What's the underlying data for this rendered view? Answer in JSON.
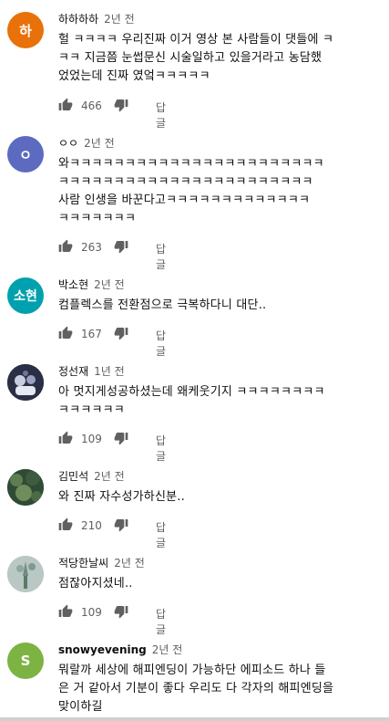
{
  "reply_label": "답글",
  "comments": [
    {
      "author": "하하하하",
      "time": "2년 전",
      "avatar_letter": "하",
      "avatar_color": "#e8710a",
      "lines": [
        "헐 ㅋㅋㅋㅋ 우리진짜 이거 영상 본 사람들이 댓들에 ㅋ",
        "ㅋㅋ 지금쯤 눈썹문신 시술일하고 있을거라고 농담했",
        "었었는데 진짜 였엌ㅋㅋㅋㅋㅋ"
      ],
      "likes": "466"
    },
    {
      "author": "ㅇㅇ",
      "time": "2년 전",
      "avatar_letter": "ㅇ",
      "avatar_color": "#5c6bc0",
      "lines": [
        "와ㅋㅋㅋㅋㅋㅋㅋㅋㅋㅋㅋㅋㅋㅋㅋㅋㅋㅋㅋㅋㅋㅋㅋ",
        "ㅋㅋㅋㅋㅋㅋㅋㅋㅋㅋㅋㅋㅋㅋㅋㅋㅋㅋㅋㅋㅋㅋㅋ",
        "사람 인생을 바꾼다고ㅋㅋㅋㅋㅋㅋㅋㅋㅋㅋㅋㅋㅋ",
        "ㅋㅋㅋㅋㅋㅋㅋ"
      ],
      "likes": "263"
    },
    {
      "author": "박소현",
      "time": "2년 전",
      "avatar_letter": "소현",
      "avatar_color": "#00a1ae",
      "lines": [
        "컴플렉스를 전환점으로 극복하다니 대단.."
      ],
      "likes": "167"
    },
    {
      "author": "정선재",
      "time": "1년 전",
      "avatar_letter": "",
      "avatar_color": "#2a2f45",
      "lines": [
        "아 멋지게성공하셨는데 왜케웃기지 ㅋㅋㅋㅋㅋㅋㅋㅋ",
        "ㅋㅋㅋㅋㅋㅋ"
      ],
      "likes": "109"
    },
    {
      "author": "김민석",
      "time": "2년 전",
      "avatar_letter": "",
      "avatar_color": "#2f4a35",
      "lines": [
        "와 진짜 자수성가하신분.."
      ],
      "likes": "210"
    },
    {
      "author": "적당한날씨",
      "time": "2년 전",
      "avatar_letter": "",
      "avatar_color": "#9fb3b0",
      "lines": [
        "점잖아지셨네.."
      ],
      "likes": "109"
    },
    {
      "author": "snowyevening",
      "time": "2년 전",
      "avatar_letter": "S",
      "avatar_color": "#7cb342",
      "lines": [
        "뭐랄까 세상에 해피엔딩이 가능하단 에피소드 하나 들",
        "은 거 같아서 기분이 좋다 우리도 다 각자의 해피엔딩을",
        "맞이하길"
      ],
      "likes": ""
    }
  ]
}
